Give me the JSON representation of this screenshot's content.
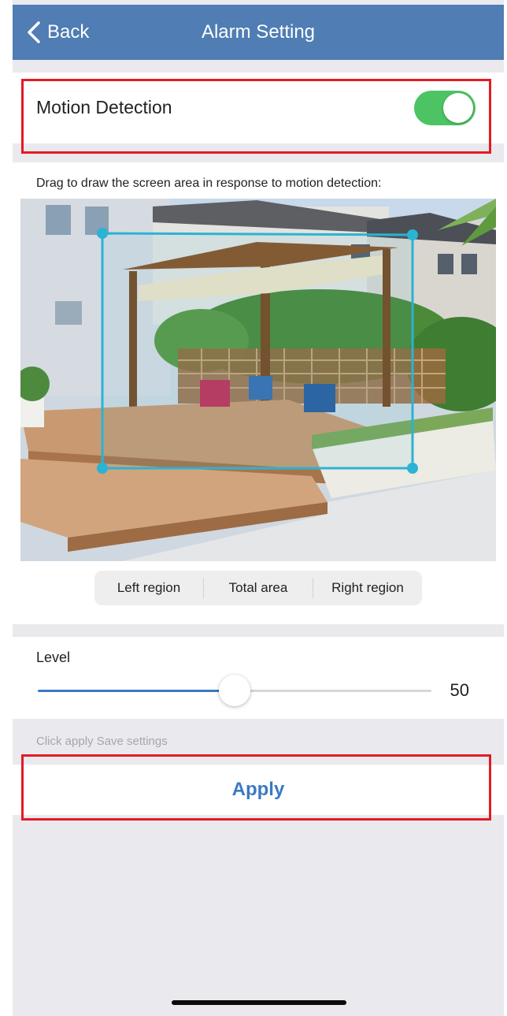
{
  "nav": {
    "back_label": "Back",
    "title": "Alarm Setting"
  },
  "motion_detection": {
    "label": "Motion Detection",
    "enabled": true
  },
  "area": {
    "instruction": "Drag to draw the screen area in response to motion detection:",
    "regions": [
      "Left region",
      "Total area",
      "Right region"
    ]
  },
  "level": {
    "label": "Level",
    "value": "50",
    "fraction": 0.5
  },
  "hint": "Click apply Save settings",
  "apply_label": "Apply",
  "colors": {
    "nav_bar": "#4f7db4",
    "toggle_on": "#4cc463",
    "accent": "#3a79c6",
    "selection_box": "#2bb3d3",
    "highlight": "#e31b23"
  },
  "icons": {
    "back": "chevron-left-icon"
  }
}
